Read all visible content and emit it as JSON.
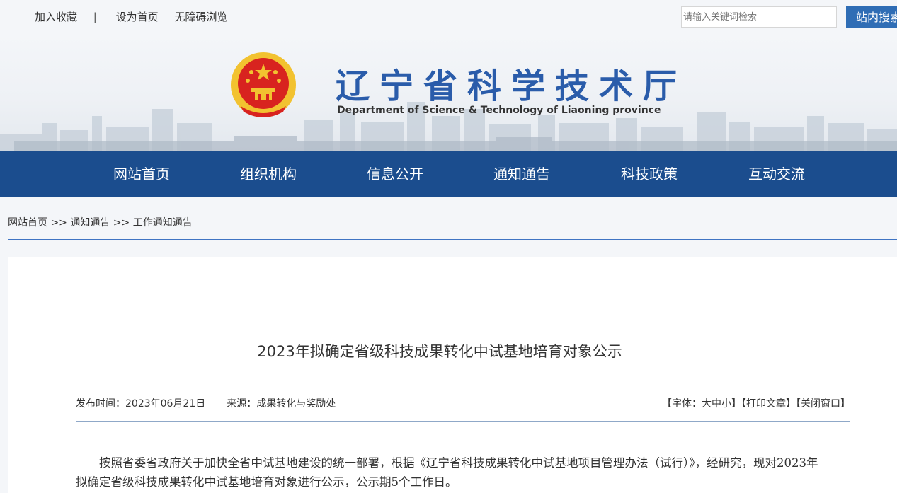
{
  "top_links": {
    "favorite": "加入收藏",
    "separator": "|",
    "set_home": "设为首页",
    "accessibility": "无障碍浏览"
  },
  "search": {
    "placeholder": "请输入关键词检索",
    "button_label": "站内搜索"
  },
  "header": {
    "title": "辽宁省科学技术厅",
    "subtitle": "Department of Science & Technology of Liaoning province"
  },
  "nav": {
    "items": [
      "网站首页",
      "组织机构",
      "信息公开",
      "通知通告",
      "科技政策",
      "互动交流"
    ]
  },
  "breadcrumb": {
    "home": "网站首页",
    "sep": ">>",
    "level1": "通知通告",
    "level2": "工作通知通告"
  },
  "article": {
    "title": "2023年拟确定省级科技成果转化中试基地培育对象公示",
    "publish_label": "发布时间：",
    "publish_date": "2023年06月21日",
    "source_label": "来源：",
    "source": "成果转化与奖励处",
    "font_size_tool": "【字体：大中小】",
    "print_tool": "【打印文章】",
    "close_tool": "【关闭窗口】",
    "body": "按照省委省政府关于加快全省中试基地建设的统一部署，根据《辽宁省科技成果转化中试基地项目管理办法（试行）》，经研究，现对2023年拟确定省级科技成果转化中试基地培育对象进行公示，公示期5个工作日。"
  },
  "colors": {
    "nav_bg": "#1b4d8e",
    "title_blue": "#2a5caa",
    "button_blue": "#2f6db5",
    "emblem_red": "#d8231f",
    "emblem_gold": "#f2c230"
  }
}
